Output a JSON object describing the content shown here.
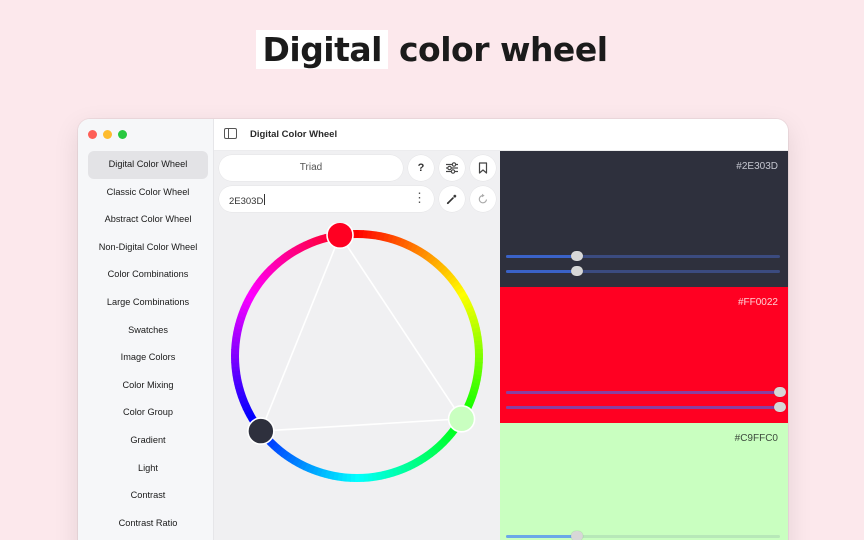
{
  "headline": {
    "highlight": "Digital",
    "rest": " color wheel"
  },
  "window": {
    "title": "Digital Color Wheel"
  },
  "sidebar": {
    "items": [
      {
        "label": "Digital Color Wheel",
        "active": true
      },
      {
        "label": "Classic Color Wheel"
      },
      {
        "label": "Abstract Color Wheel"
      },
      {
        "label": "Non-Digital Color Wheel"
      },
      {
        "label": "Color Combinations"
      },
      {
        "label": "Large Combinations"
      },
      {
        "label": "Swatches"
      },
      {
        "label": "Image Colors"
      },
      {
        "label": "Color Mixing"
      },
      {
        "label": "Color Group"
      },
      {
        "label": "Gradient"
      },
      {
        "label": "Light"
      },
      {
        "label": "Contrast"
      },
      {
        "label": "Contrast Ratio"
      }
    ]
  },
  "controls": {
    "scheme": "Triad",
    "help_glyph": "?",
    "hex_value": "2E303D",
    "more_glyph": "⋮"
  },
  "swatches": [
    {
      "hex": "#2E303D",
      "color": "#2e303d",
      "text_color": "#c4c6d0",
      "track_color": "#3b4b80",
      "fill_color": "#3a62c8",
      "sliders": [
        0.26,
        0.26
      ]
    },
    {
      "hex": "#FF0022",
      "color": "#ff0022",
      "text_color": "#ffd0d4",
      "track_color": "#b43a6c",
      "fill_color": "#8a3fa0",
      "sliders": [
        1.0,
        1.0
      ]
    },
    {
      "hex": "#C9FFC0",
      "color": "#c9ffc0",
      "text_color": "#3c4a3c",
      "track_color": "#b7e8b8",
      "fill_color": "#6aa8e8",
      "sliders": [
        0.26
      ]
    }
  ],
  "wheel": {
    "handles": [
      {
        "name": "handle-light-green",
        "color": "#c9ffc0",
        "hue": 121
      },
      {
        "name": "handle-red",
        "color": "#ff0022",
        "hue": 352
      },
      {
        "name": "handle-dark",
        "color": "#2e303d",
        "hue": 232
      }
    ]
  }
}
